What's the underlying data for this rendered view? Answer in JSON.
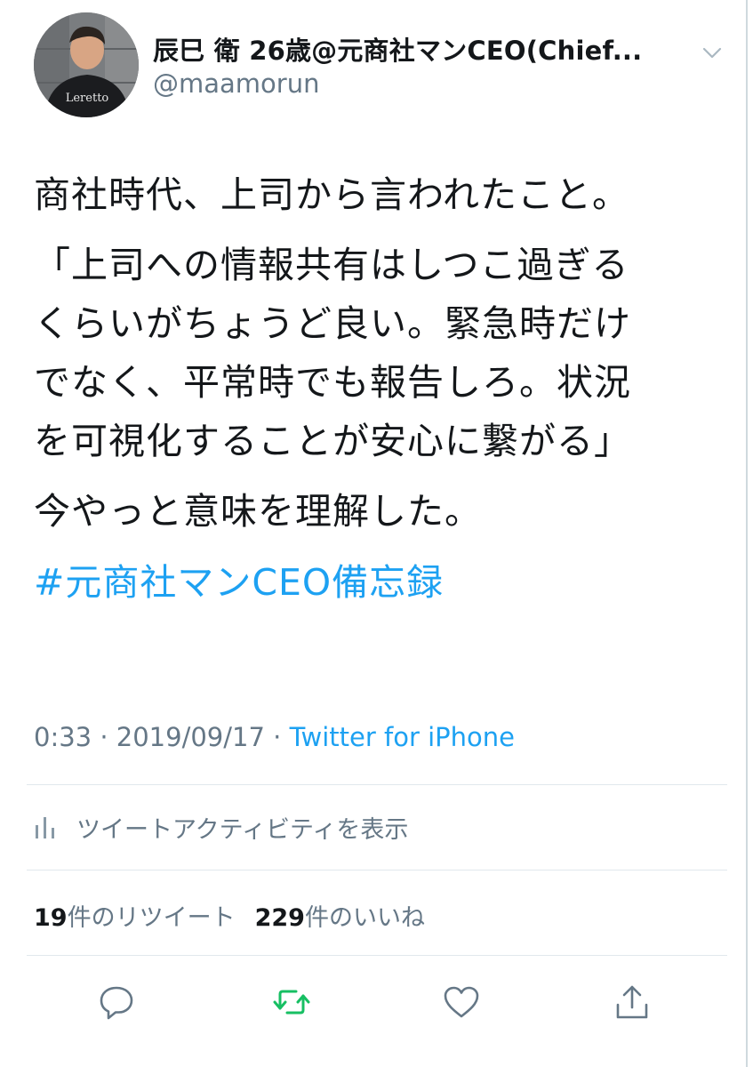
{
  "header": {
    "display_name": "辰巳 衛 26歳@元商社マンCEO(Chief...",
    "handle": "@maamorun",
    "avatar_shirt_text": "Leretto"
  },
  "tweet": {
    "line1": "商社時代、上司から言われたこと。",
    "line2": "「上司への情報共有はしつこ過ぎる",
    "line3": "くらいがちょうど良い。緊急時だけ",
    "line4": "でなく、平常時でも報告しろ。状況",
    "line5": "を可視化することが安心に繋がる」",
    "line6": "今やっと意味を理解した。",
    "hashtag": "#元商社マンCEO備忘録"
  },
  "meta": {
    "time": "0:33",
    "sep1": " · ",
    "date": "2019/09/17",
    "sep2": " · ",
    "source": "Twitter for iPhone"
  },
  "activity": {
    "label": "ツイートアクティビティを表示",
    "icon": "bar-chart-icon"
  },
  "stats": {
    "retweet_count": "19",
    "retweet_label": "件のリツイート",
    "like_count": "229",
    "like_label": "件のいいね"
  },
  "actions": {
    "reply_icon": "reply-icon",
    "retweet_icon": "retweet-icon",
    "like_icon": "heart-icon",
    "share_icon": "share-icon"
  },
  "colors": {
    "link": "#1da1f2",
    "secondary": "#657786",
    "retweet_active": "#17bf63",
    "text": "#14171a"
  }
}
